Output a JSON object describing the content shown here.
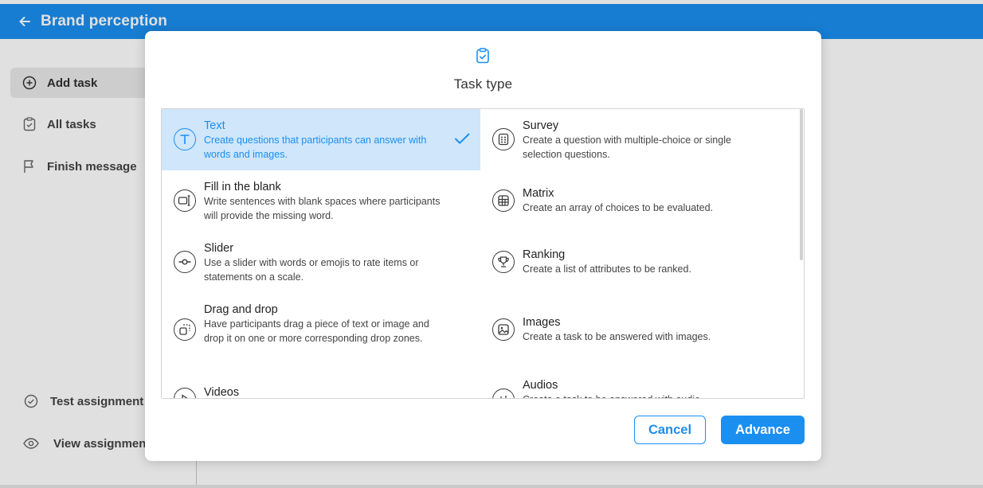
{
  "header": {
    "title": "Brand perception"
  },
  "sidebar": {
    "items": [
      {
        "label": "Add task"
      },
      {
        "label": "All tasks"
      },
      {
        "label": "Finish message"
      },
      {
        "label": "Test assignment"
      },
      {
        "label": "View assignment"
      }
    ]
  },
  "modal": {
    "title": "Task type",
    "options": [
      {
        "name": "Text",
        "desc": "Create questions that participants can answer with words and images.",
        "icon": "text-icon",
        "selected": true
      },
      {
        "name": "Survey",
        "desc": "Create a question with multiple-choice or single selection questions.",
        "icon": "survey-icon"
      },
      {
        "name": "Fill in the blank",
        "desc": "Write sentences with blank spaces where participants will provide the missing word.",
        "icon": "fill-blank-icon"
      },
      {
        "name": "Matrix",
        "desc": "Create an array of choices to be evaluated.",
        "icon": "matrix-icon"
      },
      {
        "name": "Slider",
        "desc": "Use a slider with words or emojis to rate items or statements on a scale.",
        "icon": "slider-icon"
      },
      {
        "name": "Ranking",
        "desc": "Create a list of attributes to be ranked.",
        "icon": "trophy-icon"
      },
      {
        "name": "Drag and drop",
        "desc": "Have participants drag a piece of text or image and drop it on one or more corresponding drop zones.",
        "icon": "drag-drop-icon"
      },
      {
        "name": "Images",
        "desc": "Create a task to be answered with images.",
        "icon": "image-icon"
      },
      {
        "name": "Videos",
        "desc": "",
        "icon": "video-icon"
      },
      {
        "name": "Audios",
        "desc": "Create a task to be answered with audio.",
        "icon": "audio-icon"
      }
    ],
    "cancel_label": "Cancel",
    "advance_label": "Advance"
  },
  "colors": {
    "accent": "#1b8ff0",
    "selected_bg": "#cfe6fb"
  }
}
